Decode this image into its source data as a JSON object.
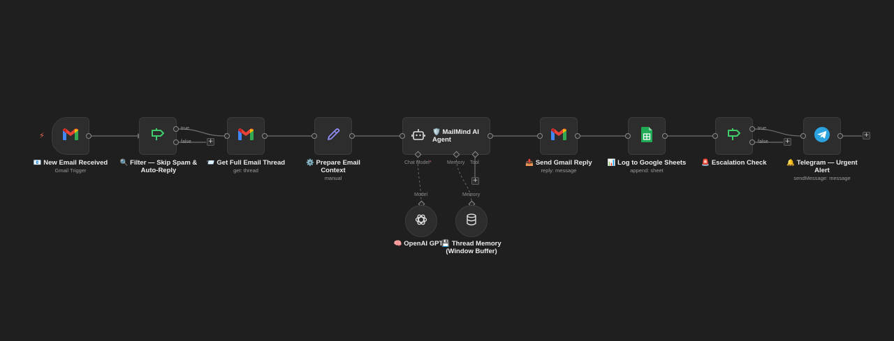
{
  "colors": {
    "background": "#1f1f1f",
    "node_bg": "#2d2d2d",
    "node_border": "#3c3c3c",
    "wire": "#707070",
    "gmail_red": "#ea4335",
    "filter_green": "#3ecf6c",
    "pencil_purple": "#8f8cf5",
    "sheets_green": "#1faa53",
    "telegram_blue": "#2aa3df",
    "trigger_bolt": "#f26b4f"
  },
  "nodes": {
    "new_email": {
      "icon": "gmail-icon",
      "title": "📧 New Email Received",
      "subtitle": "Gmail Trigger"
    },
    "filter": {
      "icon": "filter-sign-icon",
      "title_line1": "🔍 Filter — Skip Spam &",
      "title_line2": "Auto-Reply",
      "true_label": "true",
      "false_label": "false"
    },
    "get_thread": {
      "icon": "gmail-icon",
      "title": "📨 Get Full Email Thread",
      "subtitle": "get: thread"
    },
    "prepare": {
      "icon": "pencil-icon",
      "title_line1": "⚙️ Prepare Email",
      "title_line2": "Context",
      "subtitle": "manual"
    },
    "agent": {
      "icon": "robot-icon",
      "title_line1": "🛡️ MailMind AI",
      "title_line2": "Agent",
      "chat_model_label": "Chat Model",
      "required_mark": "*",
      "memory_label": "Memory",
      "tool_label": "Tool"
    },
    "send_reply": {
      "icon": "gmail-icon",
      "title": "📤 Send Gmail Reply",
      "subtitle": "reply: message"
    },
    "sheets": {
      "icon": "google-sheets-icon",
      "title": "📊 Log to Google Sheets",
      "subtitle": "append: sheet"
    },
    "escalation": {
      "icon": "filter-sign-icon",
      "title": "🚨 Escalation Check",
      "true_label": "true",
      "false_label": "false"
    },
    "telegram": {
      "icon": "telegram-icon",
      "title_line1": "🔔 Telegram — Urgent",
      "title_line2": "Alert",
      "subtitle": "sendMessage: message"
    },
    "openai": {
      "icon": "openai-icon",
      "title": "🧠 OpenAI GPT-4",
      "port_label": "Model"
    },
    "memory": {
      "icon": "database-icon",
      "title_line1": "💾 Thread Memory",
      "title_line2": "(Window Buffer)",
      "port_label": "Memory"
    }
  },
  "plus_symbol": "+",
  "trigger_symbol": "⚡"
}
